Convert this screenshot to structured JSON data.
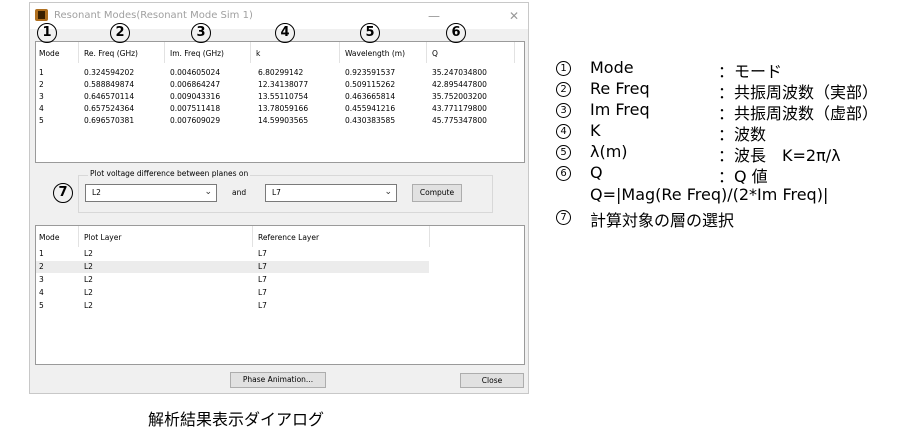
{
  "window": {
    "title": "Resonant Modes(Resonant Mode Sim 1)",
    "minimize_glyph": "—",
    "close_glyph": "✕"
  },
  "callouts": [
    "1",
    "2",
    "3",
    "4",
    "5",
    "6",
    "7"
  ],
  "modes_table": {
    "columns": [
      "Mode",
      "Re. Freq (GHz)",
      "Im. Freq (GHz)",
      "k",
      "Wavelength (m)",
      "Q"
    ],
    "rows": [
      [
        "1",
        "0.324594202",
        "0.004605024",
        "6.80299142",
        "0.923591537",
        "35.247034800"
      ],
      [
        "2",
        "0.588849874",
        "0.006864247",
        "12.34138077",
        "0.509115262",
        "42.895447800"
      ],
      [
        "3",
        "0.646570114",
        "0.009043316",
        "13.55110754",
        "0.463665814",
        "35.752003200"
      ],
      [
        "4",
        "0.657524364",
        "0.007511418",
        "13.78059166",
        "0.455941216",
        "43.771179800"
      ],
      [
        "5",
        "0.696570381",
        "0.007609029",
        "14.59903565",
        "0.430383585",
        "45.775347800"
      ]
    ]
  },
  "plot_group": {
    "label": "Plot voltage difference between planes on",
    "select_a": "L2",
    "and_label": "and",
    "select_b": "L7",
    "compute_label": "Compute"
  },
  "layers_table": {
    "columns": [
      "Mode",
      "Plot Layer",
      "Reference Layer"
    ],
    "selected_row": 1,
    "rows": [
      [
        "1",
        "L2",
        "L7"
      ],
      [
        "2",
        "L2",
        "L7"
      ],
      [
        "3",
        "L2",
        "L7"
      ],
      [
        "4",
        "L2",
        "L7"
      ],
      [
        "5",
        "L2",
        "L7"
      ]
    ]
  },
  "buttons": {
    "phase_animation": "Phase Animation...",
    "close": "Close"
  },
  "legend": [
    {
      "num": "1",
      "term": "Mode",
      "desc": "：モード"
    },
    {
      "num": "2",
      "term": "Re Freq",
      "desc": "：共振周波数（実部）"
    },
    {
      "num": "3",
      "term": "Im Freq",
      "desc": "：共振周波数（虚部）"
    },
    {
      "num": "4",
      "term": "K",
      "desc": "：波数"
    },
    {
      "num": "5",
      "term": "λ(m)",
      "desc": "：波長　K=2π/λ"
    },
    {
      "num": "6",
      "term": "Q",
      "desc": "：Q 値"
    },
    {
      "num": "7",
      "term": "計算対象の層の選択",
      "desc": ""
    }
  ],
  "q_formula": "Q=|Mag(Re Freq)/(2*Im Freq)|",
  "caption": "解析結果表示ダイアログ",
  "colors": {
    "selected_row": "#ececec",
    "dialog_bg": "#f0f0f0"
  }
}
